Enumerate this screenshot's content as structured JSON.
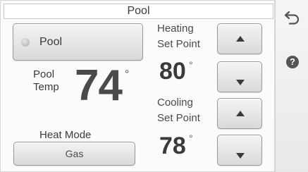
{
  "header": {
    "title": "Pool"
  },
  "pool_toggle": {
    "label": "Pool",
    "state": "off",
    "indicator_color": "#b5b5b5"
  },
  "current_temp": {
    "label_line1": "Pool",
    "label_line2": "Temp",
    "value": "74",
    "unit": "°"
  },
  "heat_mode": {
    "label": "Heat Mode",
    "value": "Gas"
  },
  "heating": {
    "label_line1": "Heating",
    "label_line2": "Set Point",
    "value": "80",
    "unit": "°"
  },
  "cooling": {
    "label_line1": "Cooling",
    "label_line2": "Set Point",
    "value": "78",
    "unit": "°"
  },
  "side_bar": {
    "back_icon": "back-arrow-icon",
    "help_icon": "help-icon",
    "help_glyph": "?"
  },
  "colors": {
    "text": "#3a3a3a",
    "button_face": "#e6e6e6",
    "button_border": "#9a9a9a",
    "sidebar_bg": "#eeeeee"
  }
}
